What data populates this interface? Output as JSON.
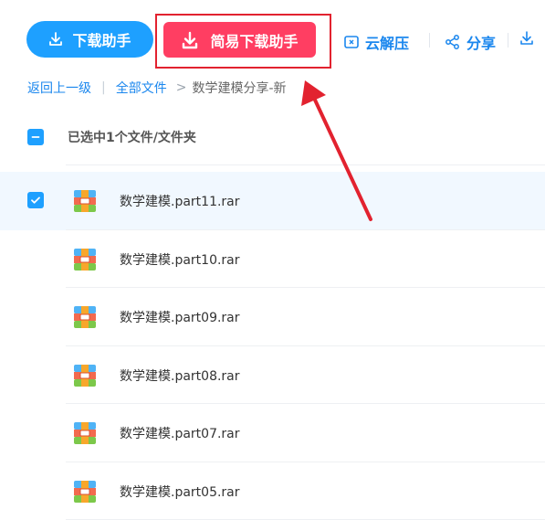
{
  "toolbar": {
    "download_label": "下载助手",
    "simple_download_label": "简易下载助手",
    "extract_label": "云解压",
    "share_label": "分享"
  },
  "breadcrumb": {
    "back": "返回上一级",
    "separator": "|",
    "all_files": "全部文件",
    "arrow": ">",
    "current": "数学建模分享-新"
  },
  "selection": {
    "text": "已选中1个文件/文件夹"
  },
  "files": [
    {
      "name": "数学建模.part11.rar",
      "selected": true
    },
    {
      "name": "数学建模.part10.rar",
      "selected": false
    },
    {
      "name": "数学建模.part09.rar",
      "selected": false
    },
    {
      "name": "数学建模.part08.rar",
      "selected": false
    },
    {
      "name": "数学建模.part07.rar",
      "selected": false
    },
    {
      "name": "数学建模.part05.rar",
      "selected": false
    }
  ],
  "colors": {
    "primary": "#1ea0ff",
    "link": "#1b87ee",
    "simple_download": "#ff3e62",
    "annotation": "#e2222f"
  },
  "icons": {
    "download": "download-icon",
    "extract": "extract-icon",
    "share": "share-icon",
    "file": "rar-archive-icon"
  }
}
